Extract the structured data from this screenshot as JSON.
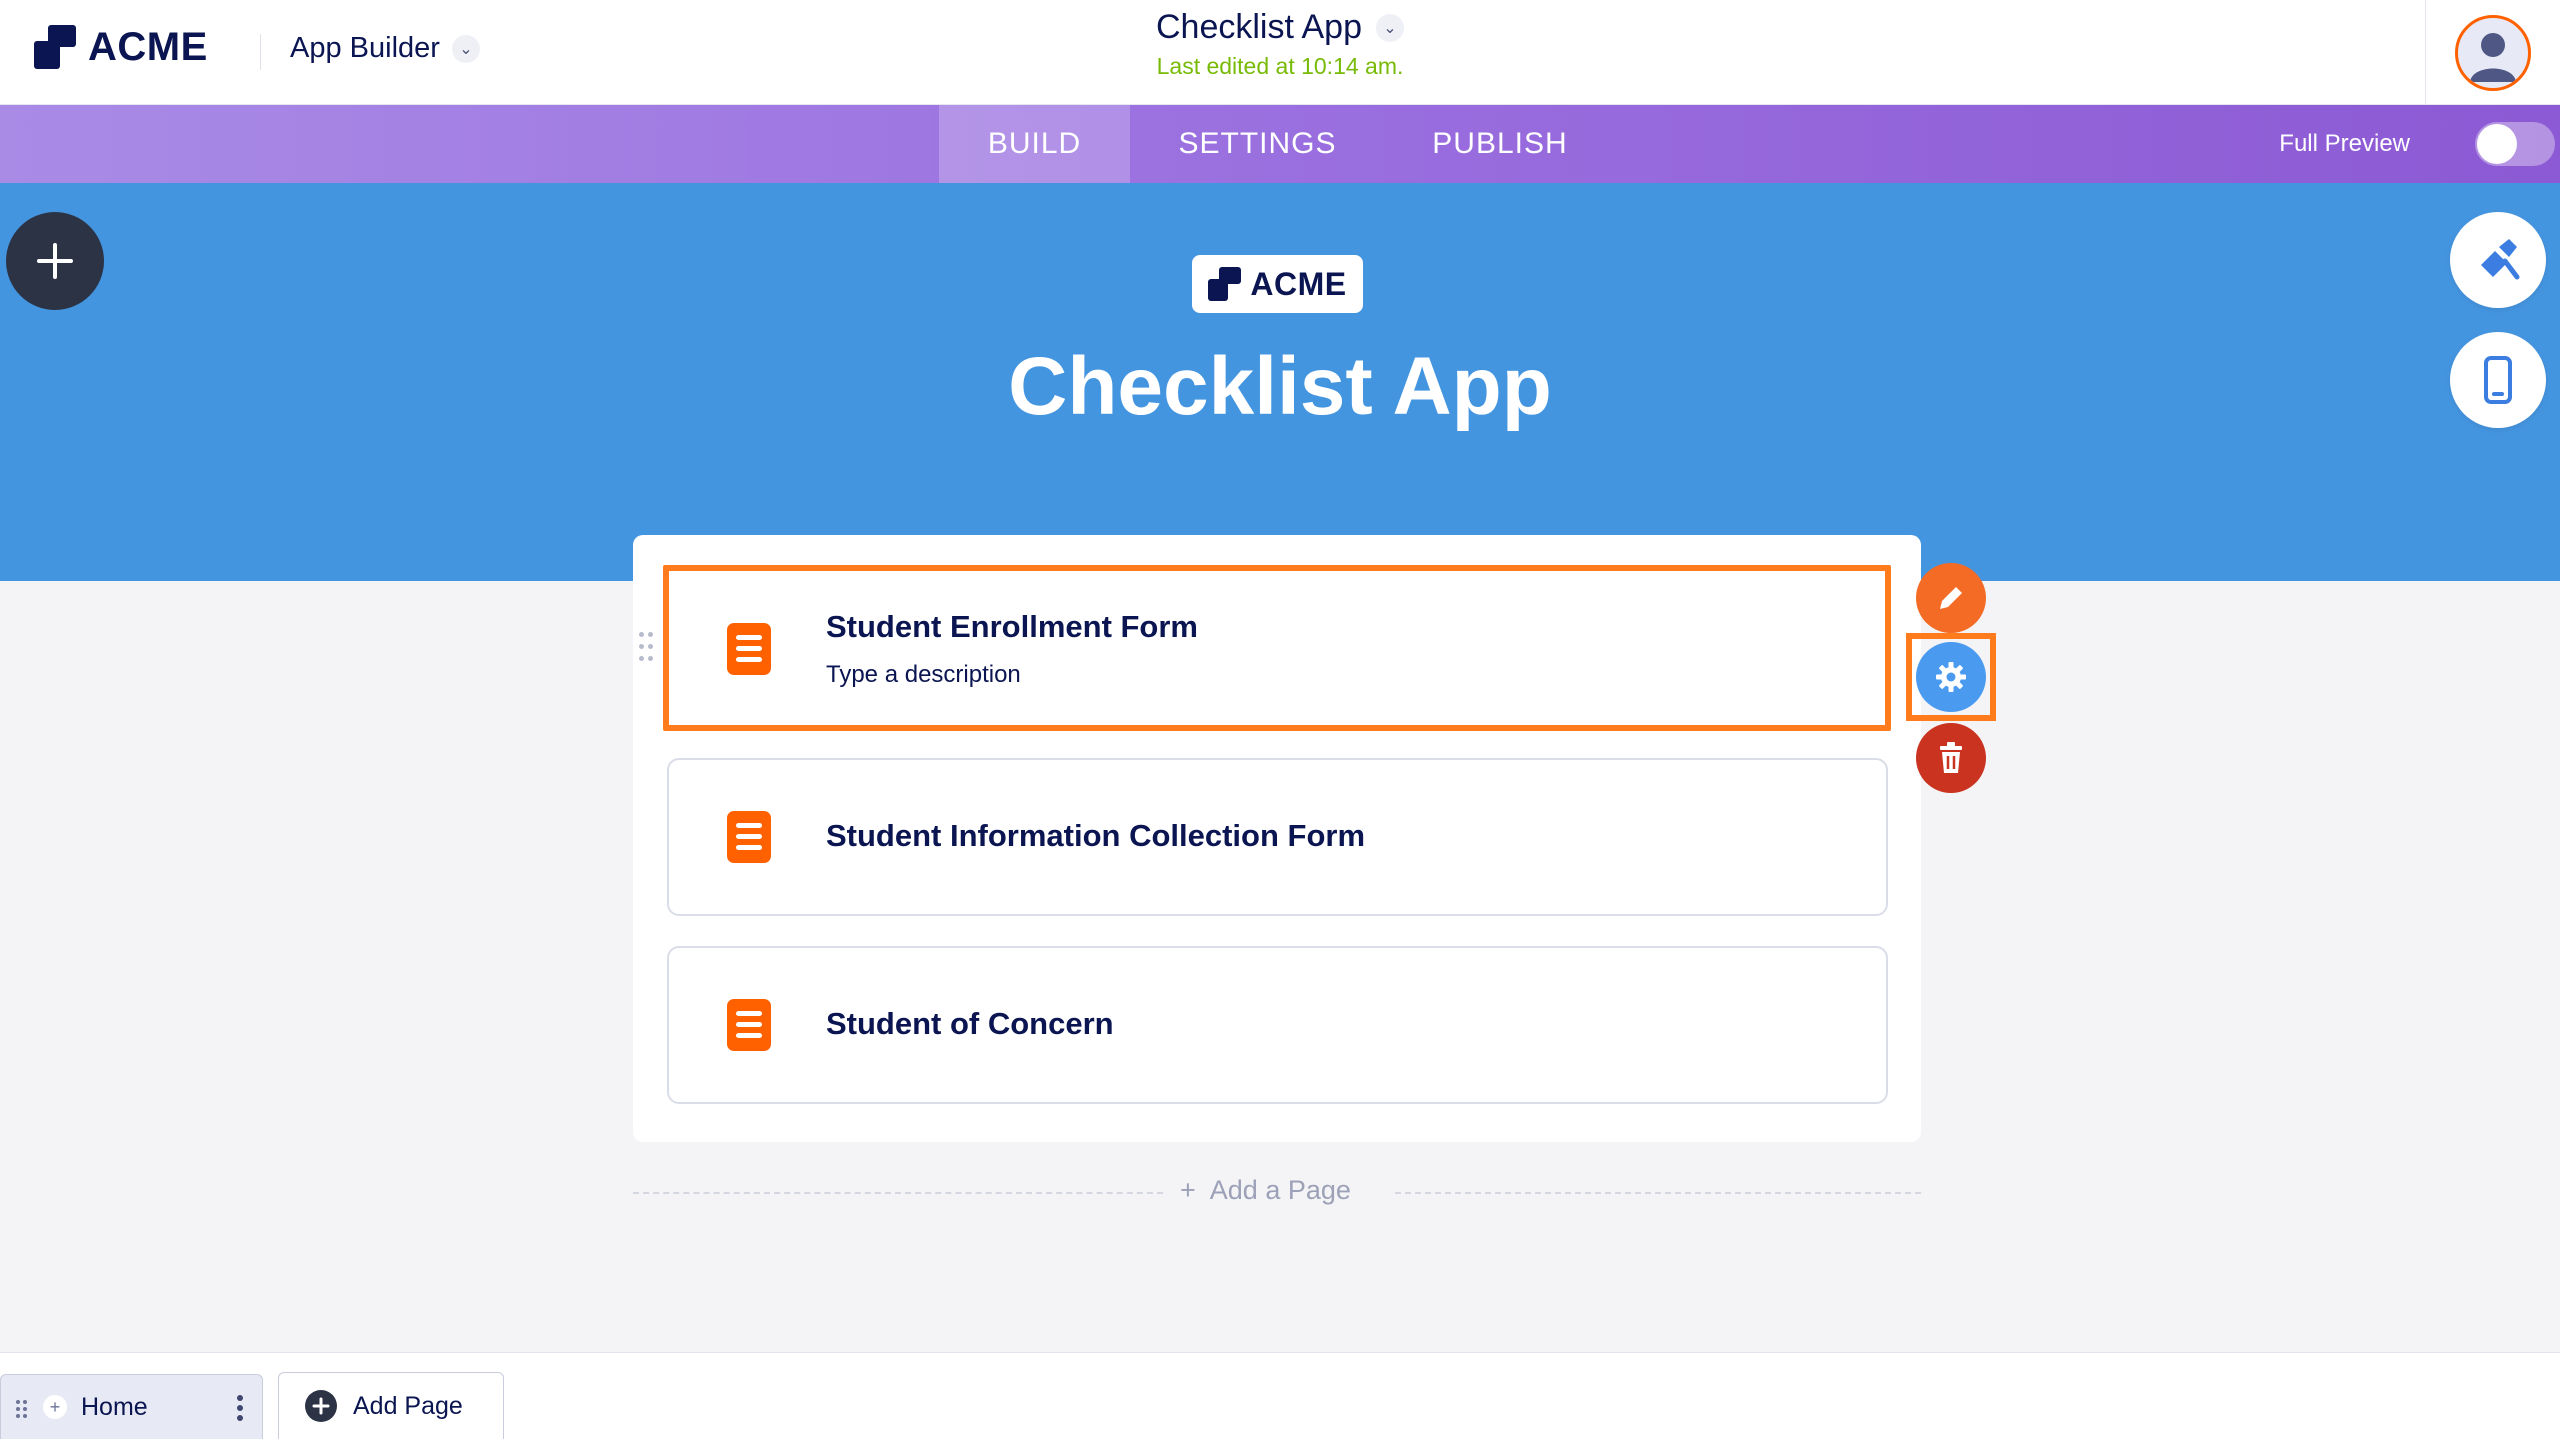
{
  "header": {
    "brand": "ACME",
    "app_builder_label": "App Builder",
    "app_title": "Checklist App",
    "last_edited": "Last edited at 10:14 am."
  },
  "nav": {
    "tabs": [
      {
        "label": "BUILD",
        "active": true
      },
      {
        "label": "SETTINGS",
        "active": false
      },
      {
        "label": "PUBLISH",
        "active": false
      }
    ],
    "full_preview_label": "Full Preview",
    "full_preview_on": false
  },
  "hero": {
    "logo_text": "ACME",
    "title": "Checklist App",
    "background_color": "#4495e0"
  },
  "items": [
    {
      "title": "Student Enrollment Form",
      "description": "Type a description",
      "selected": true,
      "icon": "form-icon"
    },
    {
      "title": "Student Information Collection Form",
      "description": "",
      "selected": false,
      "icon": "form-icon"
    },
    {
      "title": "Student of Concern",
      "description": "",
      "selected": false,
      "icon": "form-icon"
    }
  ],
  "item_actions": {
    "edit_icon": "pencil-icon",
    "settings_icon": "gear-icon",
    "delete_icon": "trash-icon"
  },
  "add_page_link": "Add a Page",
  "bottom": {
    "home_tab": "Home",
    "add_page_tab": "Add Page"
  },
  "colors": {
    "accent_orange": "#ff6100",
    "highlight_orange": "#ff7b1c",
    "purple_nav": "#9a6fdf",
    "green_status": "#78bb07",
    "settings_blue": "#4a9bf0",
    "delete_red": "#c9331f"
  }
}
